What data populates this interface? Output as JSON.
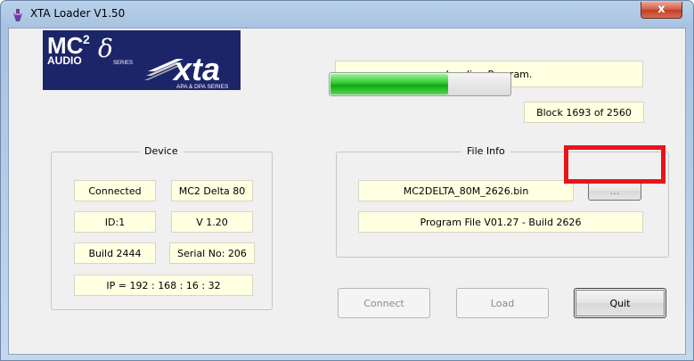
{
  "window": {
    "title": "XTA Loader V1.50",
    "close_label": "x"
  },
  "logo": {
    "mc": "MC",
    "sup": "2",
    "audio": "AUDIO",
    "delta": "δ",
    "series": "SERIES",
    "xta": "xta",
    "apa": "APA & DPA SERIES"
  },
  "status": {
    "message": "Loading Program.",
    "block": "Block 1693 of 2560",
    "progress": 0.65
  },
  "device": {
    "title": "Device",
    "state": "Connected",
    "model": "MC2 Delta 80",
    "id": "ID:1",
    "version": "V 1.20",
    "build": "Build 2444",
    "serial": "Serial No: 206",
    "ip": "IP = 192 : 168 : 16 : 32"
  },
  "file_info": {
    "title": "File Info",
    "filename": "MC2DELTA_80M_2626.bin",
    "browse_label": "...",
    "description": "Program File V01.27 - Build 2626"
  },
  "buttons": {
    "connect": "Connect",
    "load": "Load",
    "quit": "Quit"
  },
  "colors": {
    "field_bg": "#ffffe1",
    "highlight": "#e8141b",
    "progress": "#1fbe1f"
  }
}
